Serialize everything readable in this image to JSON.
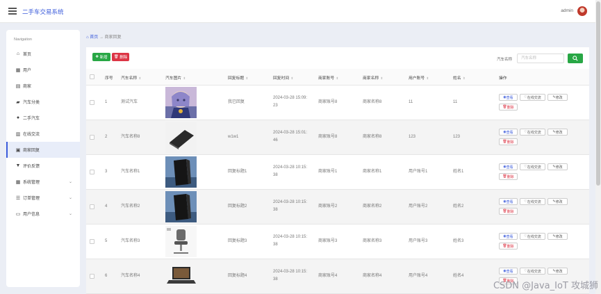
{
  "app": {
    "title": "二手车交易系统",
    "username": "admin"
  },
  "sidebar": {
    "title": "Navigation",
    "items": [
      {
        "label": "首页",
        "icon": "home-icon"
      },
      {
        "label": "用户",
        "icon": "grid-icon"
      },
      {
        "label": "商家",
        "icon": "store-icon"
      },
      {
        "label": "汽车分类",
        "icon": "car-icon"
      },
      {
        "label": "二手汽车",
        "icon": "person-icon"
      },
      {
        "label": "在线交流",
        "icon": "chart-icon"
      },
      {
        "label": "商家回复",
        "icon": "reply-icon",
        "active": true
      },
      {
        "label": "评价反馈",
        "icon": "feedback-icon"
      },
      {
        "label": "系统管理",
        "icon": "grid-icon",
        "chevron": true
      },
      {
        "label": "订单管理",
        "icon": "list-icon",
        "chevron": true
      },
      {
        "label": "用户信息",
        "icon": "user-card-icon",
        "chevron": true
      }
    ]
  },
  "breadcrumb": {
    "home": "首页",
    "sep": "→",
    "current": "商家回复"
  },
  "toolbar": {
    "add_label": "新增",
    "delete_label": "删除"
  },
  "search": {
    "label": "汽车名称",
    "placeholder": "汽车名称"
  },
  "table": {
    "headers": [
      "序号",
      "汽车名称",
      "汽车图片",
      "回复标题",
      "回复时间",
      "商家账号",
      "商家名称",
      "用户账号",
      "姓名",
      "操作"
    ],
    "rows": [
      {
        "index": "1",
        "car_name": "测试汽车",
        "image": "figure",
        "reply_title": "我已回复",
        "time_a": "2024-03-28 15:09:",
        "time_b": "23",
        "merchant_account": "商家账号8",
        "merchant_name": "商家名称8",
        "user_account": "11",
        "name": "11"
      },
      {
        "index": "2",
        "car_name": "汽车名称8",
        "image": "laptop",
        "reply_title": "w1w1",
        "time_a": "2024-03-28 15:01:",
        "time_b": "46",
        "merchant_account": "商家账号8",
        "merchant_name": "商家名称8",
        "user_account": "123",
        "name": "123"
      },
      {
        "index": "3",
        "car_name": "汽车名称1",
        "image": "console",
        "reply_title": "回复标题1",
        "time_a": "2024-03-28 10:15:",
        "time_b": "38",
        "merchant_account": "商家账号1",
        "merchant_name": "商家名称1",
        "user_account": "用户账号1",
        "name": "姓名1"
      },
      {
        "index": "4",
        "car_name": "汽车名称2",
        "image": "console",
        "reply_title": "回复标题2",
        "time_a": "2024-03-28 10:15:",
        "time_b": "38",
        "merchant_account": "商家账号2",
        "merchant_name": "商家名称2",
        "user_account": "用户账号2",
        "name": "姓名2"
      },
      {
        "index": "5",
        "car_name": "汽车名称3",
        "image": "chair",
        "reply_title": "回复标题3",
        "time_a": "2024-03-28 10:15:",
        "time_b": "38",
        "merchant_account": "商家账号3",
        "merchant_name": "商家名称3",
        "user_account": "用户账号3",
        "name": "姓名3"
      },
      {
        "index": "6",
        "car_name": "汽车名称4",
        "image": "laptop2",
        "reply_title": "回复标题4",
        "time_a": "2024-03-28 10:15:",
        "time_b": "38",
        "merchant_account": "商家账号4",
        "merchant_name": "商家名称4",
        "user_account": "用户账号4",
        "name": "姓名4"
      }
    ],
    "actions": {
      "view": "查看",
      "chat": "在线交流",
      "edit": "修改",
      "delete": "删除"
    }
  },
  "watermark": "CSDN @Java_IoT 攻城狮",
  "colors": {
    "primary": "#3b5bdb",
    "success": "#28a745",
    "danger": "#dc3545"
  }
}
